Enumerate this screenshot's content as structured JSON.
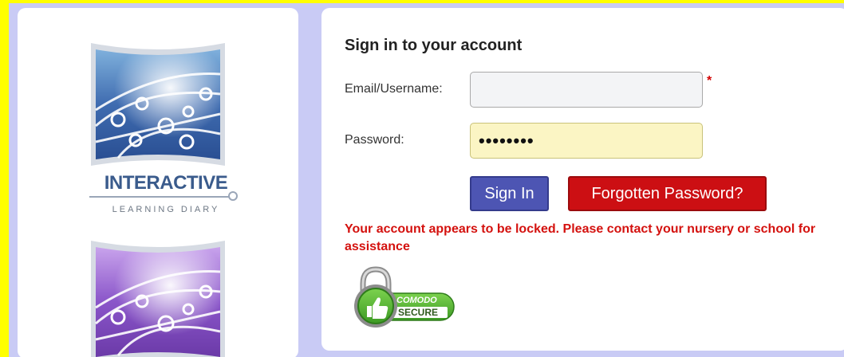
{
  "logo": {
    "title": "INTERACTIVE",
    "subtitle": "LEARNING DIARY"
  },
  "signin": {
    "title": "Sign in to your account",
    "email_label": "Email/Username:",
    "email_value": "",
    "email_placeholder": "",
    "required_marker": "*",
    "password_label": "Password:",
    "password_value": "••••••••",
    "signin_button": "Sign In",
    "forgot_button": "Forgotten Password?",
    "error": "Your account appears to be locked. Please contact your nursery or school for assistance"
  },
  "badge": {
    "brand": "COMODO",
    "text": "SECURE"
  },
  "colors": {
    "page_border": "#ffff00",
    "panel_bg": "#c9cbf5",
    "signin_button": "#4d55b3",
    "forgot_button": "#cc0f13",
    "error_text": "#d4110e",
    "badge_green": "#4caf3a"
  }
}
